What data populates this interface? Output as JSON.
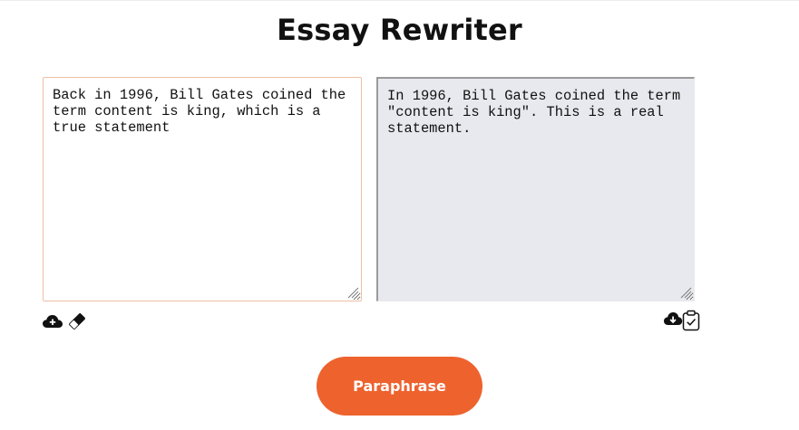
{
  "page": {
    "title": "Essay Rewriter"
  },
  "input": {
    "value": "Back in 1996, Bill Gates coined the term content is king, which is a true statement"
  },
  "output": {
    "value": "In 1996, Bill Gates coined the term \"content is king\". This is a real statement."
  },
  "toolbar_left": {
    "icons": [
      "cloud-upload-icon",
      "eraser-icon"
    ]
  },
  "toolbar_right": {
    "icons": [
      "cloud-download-icon",
      "clipboard-check-icon"
    ]
  },
  "action": {
    "button_label": "Paraphrase"
  },
  "colors": {
    "accent": "#ee622e",
    "input_border": "#efbfa6",
    "output_background": "#e8e9ee"
  }
}
